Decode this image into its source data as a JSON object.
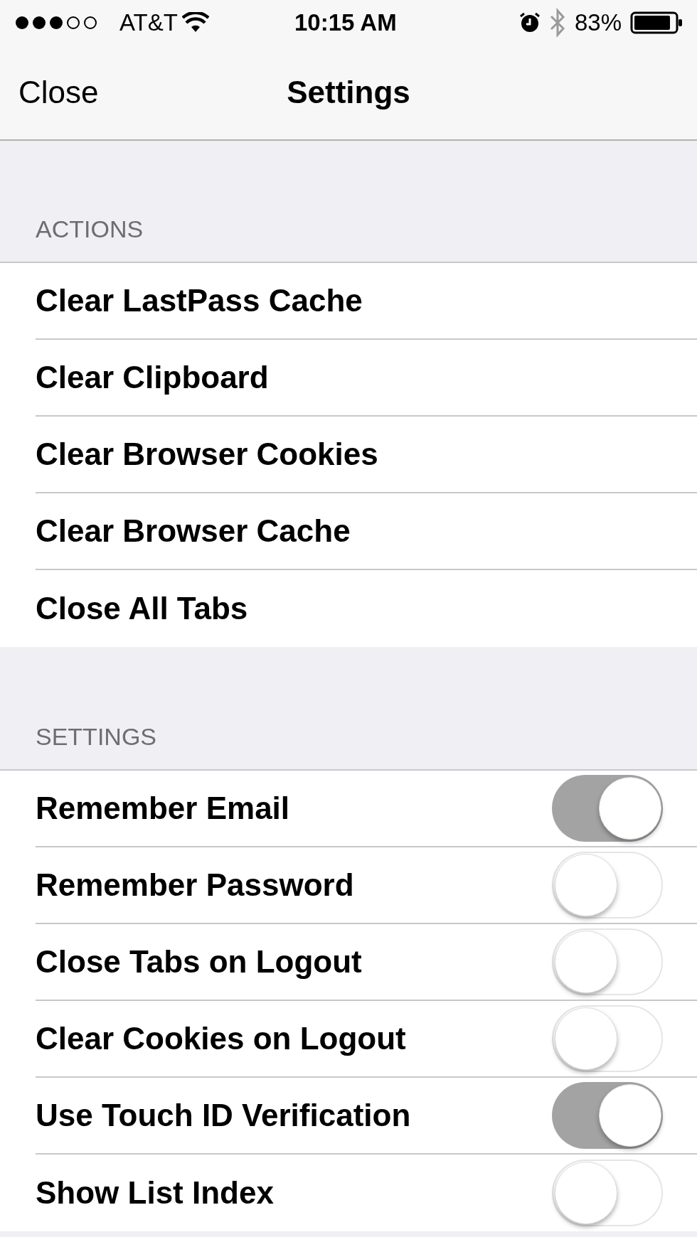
{
  "status_bar": {
    "carrier": "AT&T",
    "time": "10:15 AM",
    "battery": "83%"
  },
  "nav": {
    "left_button": "Close",
    "title": "Settings"
  },
  "sections": [
    {
      "header": "ACTIONS",
      "rows": [
        {
          "kind": "action",
          "label": "Clear LastPass Cache"
        },
        {
          "kind": "action",
          "label": "Clear Clipboard"
        },
        {
          "kind": "action",
          "label": "Clear Browser Cookies"
        },
        {
          "kind": "action",
          "label": "Clear Browser Cache"
        },
        {
          "kind": "action",
          "label": "Close All Tabs"
        }
      ]
    },
    {
      "header": "SETTINGS",
      "rows": [
        {
          "kind": "toggle",
          "label": "Remember Email",
          "on": true
        },
        {
          "kind": "toggle",
          "label": "Remember Password",
          "on": false
        },
        {
          "kind": "toggle",
          "label": "Close Tabs on Logout",
          "on": false
        },
        {
          "kind": "toggle",
          "label": "Clear Cookies on Logout",
          "on": false
        },
        {
          "kind": "toggle",
          "label": "Use Touch ID Verification",
          "on": true
        },
        {
          "kind": "toggle",
          "label": "Show List Index",
          "on": false
        }
      ]
    }
  ]
}
